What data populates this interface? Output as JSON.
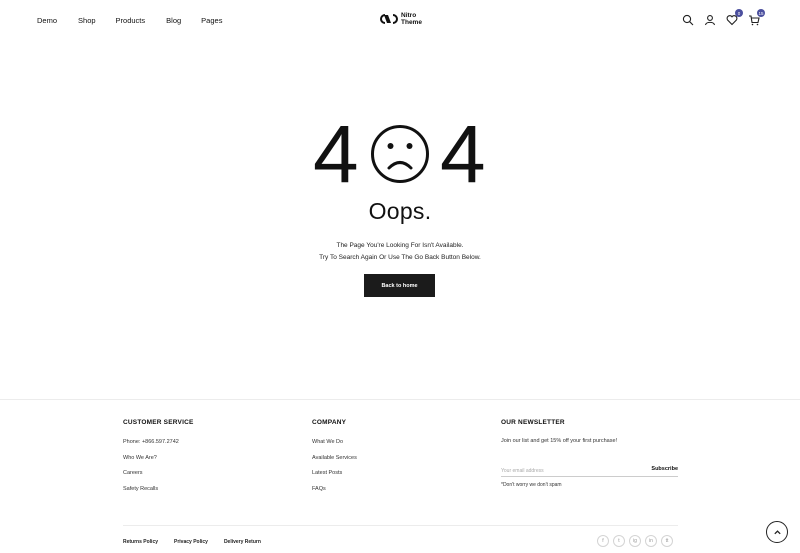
{
  "header": {
    "nav": [
      "Demo",
      "Shop",
      "Products",
      "Blog",
      "Pages"
    ],
    "logo_line1": "Nitro",
    "logo_line2": "Theme",
    "wishlist_count": "0",
    "cart_count": "15"
  },
  "error": {
    "code_left": "4",
    "code_right": "4",
    "title": "Oops.",
    "line1": "The Page You're Looking For Isn't Available.",
    "line2": "Try To Search Again Or Use The Go Back Button Below.",
    "button": "Back to home"
  },
  "footer": {
    "customer_service": {
      "title": "CUSTOMER SERVICE",
      "links": [
        "Phone: +866.597.2742",
        "Who We Are?",
        "Careers",
        "Safety Recalls"
      ]
    },
    "company": {
      "title": "COMPANY",
      "links": [
        "What We Do",
        "Available Services",
        "Latest Posts",
        "FAQs"
      ]
    },
    "newsletter": {
      "title": "OUR NEWSLETTER",
      "text": "Join our list and get 15% off your first purchase!",
      "placeholder": "Your email address",
      "subscribe": "Subscribe",
      "note": "*Don't worry we don't spam"
    },
    "policies": [
      "Returns Policy",
      "Privacy Policy",
      "Delivery Return"
    ],
    "socials": [
      "f",
      "t",
      "ig",
      "in",
      "tt"
    ]
  },
  "colors": {
    "badge": "#4b4f9e",
    "button": "#1b1b1b"
  }
}
